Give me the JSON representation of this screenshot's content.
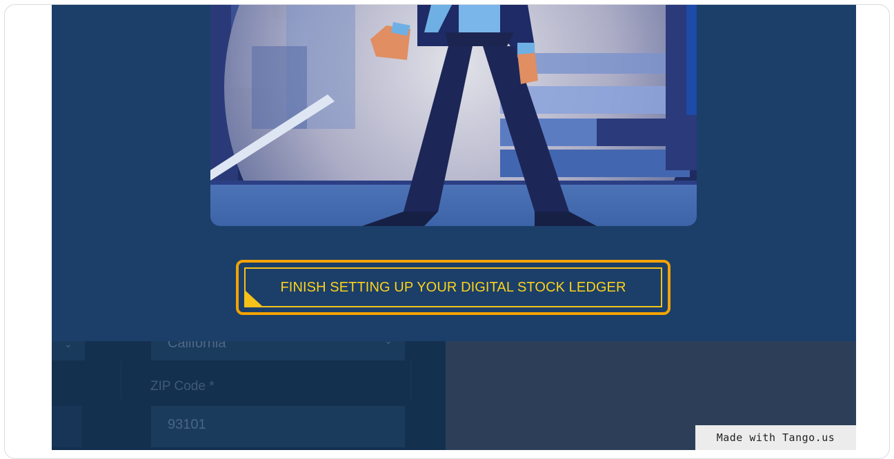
{
  "modal": {
    "cta_label": "FINISH SETTING UP YOUR DIGITAL STOCK LEDGER",
    "illustration": "superhero-figure-illustration"
  },
  "form": {
    "state_select_value": "California",
    "zip_label": "ZIP Code *",
    "zip_value": "93101"
  },
  "watermark": {
    "text": "Made with Tango.us"
  },
  "colors": {
    "modal_bg": "#1b3f69",
    "cta_border": "#f5a300",
    "cta_text": "#ffd21a"
  }
}
